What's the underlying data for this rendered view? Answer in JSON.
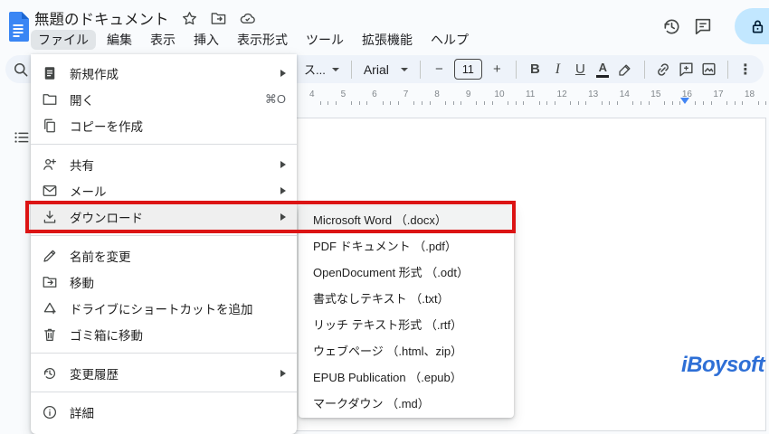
{
  "header": {
    "doc_title": "無題のドキュメント",
    "menus": [
      "ファイル",
      "編集",
      "表示",
      "挿入",
      "表示形式",
      "ツール",
      "拡張機能",
      "ヘルプ"
    ],
    "active_menu": "ファイル"
  },
  "toolbar": {
    "style_selector": "ス...",
    "font_name": "Arial",
    "font_size": "11",
    "minus": "−",
    "plus": "+",
    "bold": "B",
    "italic": "I",
    "underline": "U",
    "text_color": "A",
    "more": "⋮"
  },
  "ruler": {
    "numbers": [
      "4",
      "5",
      "6",
      "7",
      "8",
      "9",
      "10",
      "11",
      "12",
      "13",
      "14",
      "15",
      "16",
      "17",
      "18"
    ]
  },
  "file_menu": {
    "items": [
      {
        "name": "new",
        "icon": "new-doc",
        "label": "新規作成",
        "submenu": true
      },
      {
        "name": "open",
        "icon": "folder-open",
        "label": "開く",
        "shortcut": "⌘O"
      },
      {
        "name": "make-copy",
        "icon": "copy",
        "label": "コピーを作成"
      },
      {
        "divider": true
      },
      {
        "name": "share",
        "icon": "person-add",
        "label": "共有",
        "submenu": true
      },
      {
        "name": "email",
        "icon": "mail",
        "label": "メール",
        "submenu": true
      },
      {
        "name": "download",
        "icon": "download",
        "label": "ダウンロード",
        "submenu": true,
        "hover": true
      },
      {
        "divider": true
      },
      {
        "name": "rename",
        "icon": "pencil",
        "label": "名前を変更"
      },
      {
        "name": "move",
        "icon": "folder-move",
        "label": "移動"
      },
      {
        "name": "add-shortcut-to-drive",
        "icon": "drive-shortcut",
        "label": "ドライブにショートカットを追加"
      },
      {
        "name": "move-to-trash",
        "icon": "trash",
        "label": "ゴミ箱に移動"
      },
      {
        "divider": true
      },
      {
        "name": "version-history",
        "icon": "history",
        "label": "変更履歴",
        "submenu": true
      },
      {
        "divider": true
      },
      {
        "name": "details",
        "icon": "info",
        "label": "詳細"
      }
    ]
  },
  "download_submenu": {
    "items": [
      {
        "name": "docx",
        "label": "Microsoft Word （.docx）",
        "hover": true
      },
      {
        "name": "pdf",
        "label": "PDF ドキュメント （.pdf）"
      },
      {
        "name": "odt",
        "label": "OpenDocument 形式 （.odt）"
      },
      {
        "name": "txt",
        "label": "書式なしテキスト （.txt）"
      },
      {
        "name": "rtf",
        "label": "リッチ テキスト形式 （.rtf）"
      },
      {
        "name": "html-zip",
        "label": "ウェブページ （.html、zip）"
      },
      {
        "name": "epub",
        "label": "EPUB Publication （.epub）"
      },
      {
        "name": "md",
        "label": "マークダウン （.md）"
      }
    ]
  },
  "watermark": {
    "text": "iBoysoft",
    "color": "#2e6fd6"
  },
  "colors": {
    "annotation_red": "#dc1414",
    "share_pill": "#c2e7ff",
    "accent_blue": "#4285f4",
    "docs_logo_blue": "#3a86f4"
  }
}
